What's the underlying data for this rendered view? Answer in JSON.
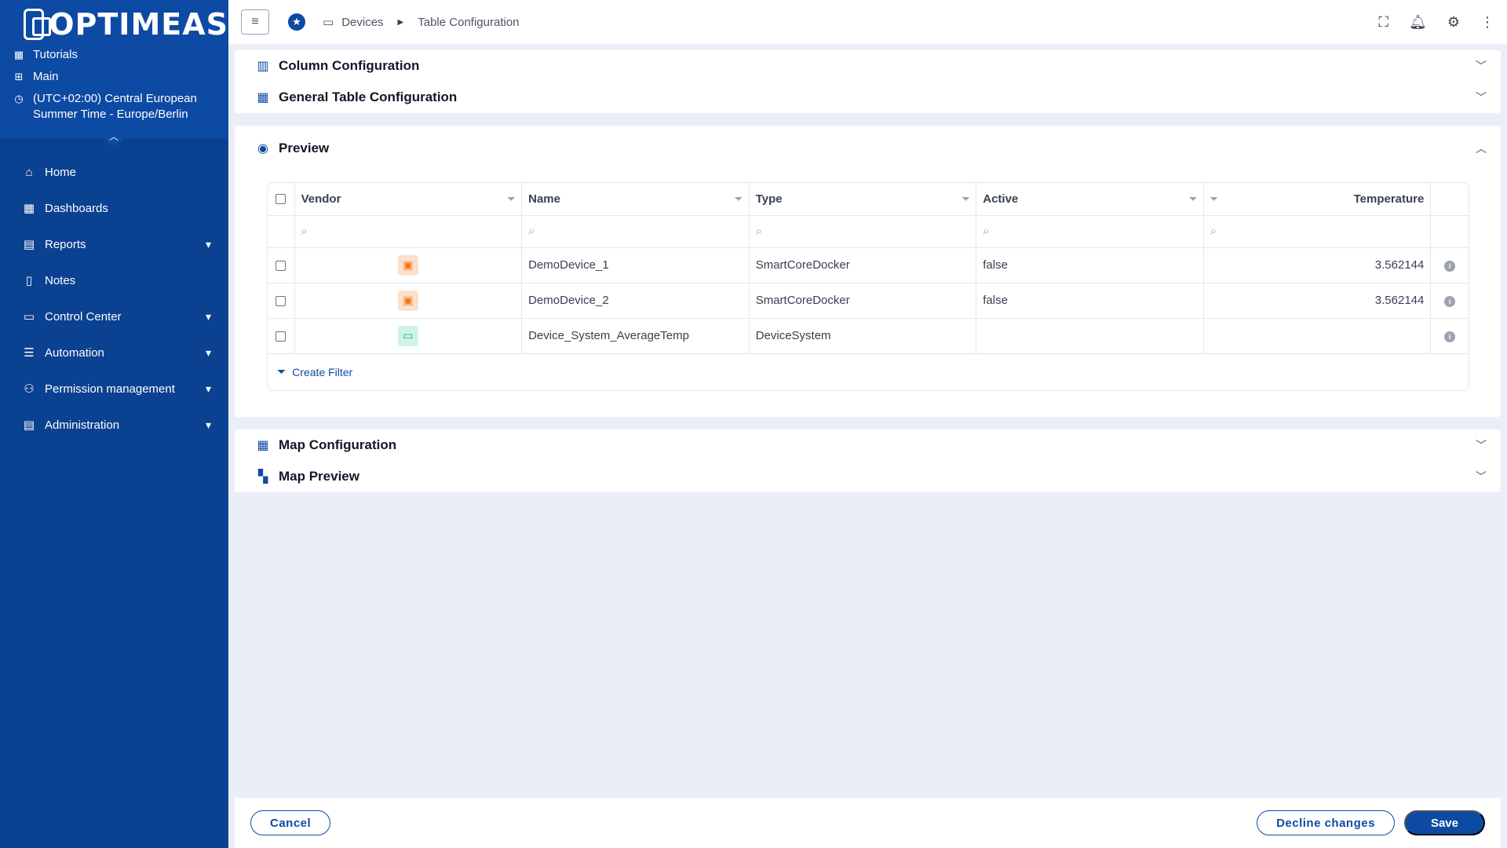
{
  "app": {
    "logo_text": "OPTIMEAS"
  },
  "sidebar": {
    "meta": {
      "tutorials": "Tutorials",
      "main": "Main",
      "timezone_line1": "(UTC+02:00) Central European",
      "timezone_line2": "Summer Time - Europe/Berlin"
    },
    "items": [
      {
        "label": "Home",
        "icon": "home-icon",
        "expandable": false
      },
      {
        "label": "Dashboards",
        "icon": "dashboard-icon",
        "expandable": false
      },
      {
        "label": "Reports",
        "icon": "clipboard-icon",
        "expandable": true
      },
      {
        "label": "Notes",
        "icon": "document-icon",
        "expandable": false
      },
      {
        "label": "Control Center",
        "icon": "devices-icon",
        "expandable": true
      },
      {
        "label": "Automation",
        "icon": "sliders-icon",
        "expandable": true
      },
      {
        "label": "Permission management",
        "icon": "users-icon",
        "expandable": true
      },
      {
        "label": "Administration",
        "icon": "admin-document-icon",
        "expandable": true
      }
    ]
  },
  "breadcrumb": {
    "devices": "Devices",
    "current": "Table Configuration"
  },
  "sections": {
    "column_config": "Column Configuration",
    "general_table_config": "General Table Configuration",
    "preview": "Preview",
    "map_config": "Map Configuration",
    "map_preview": "Map Preview"
  },
  "table": {
    "columns": [
      "Vendor",
      "Name",
      "Type",
      "Active",
      "Temperature"
    ],
    "rows": [
      {
        "vendor_icon": "chip-icon",
        "vendor_color": "#f97316",
        "name": "DemoDevice_1",
        "type": "SmartCoreDocker",
        "active": "false",
        "temperature": "3.562144"
      },
      {
        "vendor_icon": "chip-icon",
        "vendor_color": "#f97316",
        "name": "DemoDevice_2",
        "type": "SmartCoreDocker",
        "active": "false",
        "temperature": "3.562144"
      },
      {
        "vendor_icon": "devices-icon",
        "vendor_color": "#10b981",
        "name": "Device_System_AverageTemp",
        "type": "DeviceSystem",
        "active": "",
        "temperature": ""
      }
    ],
    "create_filter": "Create Filter"
  },
  "footer": {
    "cancel": "Cancel",
    "decline": "Decline changes",
    "save": "Save"
  },
  "colors": {
    "primary": "#0d4aa3",
    "sidebar": "#0b4191",
    "background": "#e9eef7"
  }
}
